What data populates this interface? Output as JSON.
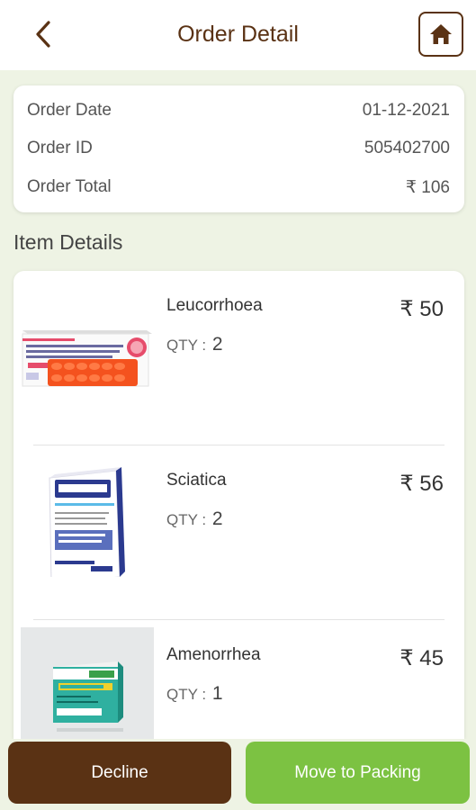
{
  "header": {
    "title": "Order Detail",
    "back_icon": "chevron-left-icon",
    "home_icon": "home-icon",
    "accent_color": "#5a3214"
  },
  "summary": {
    "order_date_label": "Order Date",
    "order_date": "01-12-2021",
    "order_id_label": "Order ID",
    "order_id": "505402700",
    "order_total_label": "Order Total",
    "order_total": "₹ 106"
  },
  "item_details_title": "Item Details",
  "items": [
    {
      "name": "Leucorrhoea",
      "qty_label": "QTY :",
      "qty": "2",
      "price": "₹ 50"
    },
    {
      "name": "Sciatica",
      "qty_label": "QTY :",
      "qty": "2",
      "price": "₹ 56"
    },
    {
      "name": "Amenorrhea",
      "qty_label": "QTY :",
      "qty": "1",
      "price": "₹ 45"
    }
  ],
  "footer": {
    "decline_label": "Decline",
    "move_label": "Move to Packing",
    "decline_color": "#5a3214",
    "move_color": "#7cc242"
  }
}
